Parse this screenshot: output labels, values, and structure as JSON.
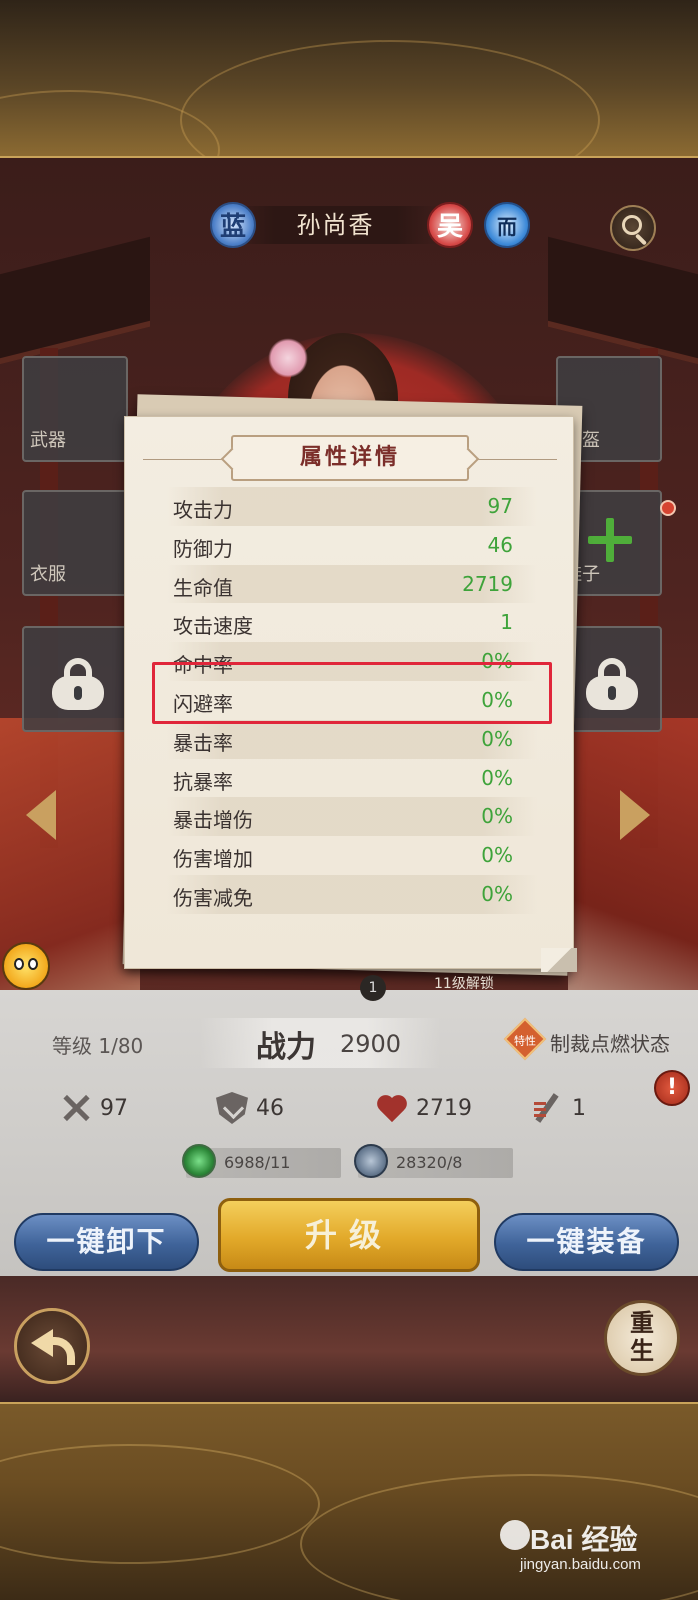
{
  "hero": {
    "name": "孙尚香",
    "rarity_badge": "蓝",
    "faction_badge": "吴",
    "type_badge": "而"
  },
  "equipment": {
    "weapon_label": "武器",
    "helmet_label": "头盔",
    "clothes_label": "衣服",
    "shoes_label": "鞋子"
  },
  "popup": {
    "title": "属性详情",
    "attributes": [
      {
        "name": "攻击力",
        "value": "97"
      },
      {
        "name": "防御力",
        "value": "46"
      },
      {
        "name": "生命值",
        "value": "2719"
      },
      {
        "name": "攻击速度",
        "value": "1"
      },
      {
        "name": "命中率",
        "value": "0%"
      },
      {
        "name": "闪避率",
        "value": "0%"
      },
      {
        "name": "暴击率",
        "value": "0%"
      },
      {
        "name": "抗暴率",
        "value": "0%"
      },
      {
        "name": "暴击增伤",
        "value": "0%"
      },
      {
        "name": "伤害增加",
        "value": "0%"
      },
      {
        "name": "伤害减免",
        "value": "0%"
      }
    ]
  },
  "status": {
    "unlock_count": "1",
    "unlock_text": "11级解锁",
    "level": "等级 1/80",
    "power_label": "战力",
    "power_value": "2900",
    "special_badge": "特性",
    "ignite_status": "制裁点燃状态",
    "alert": "!"
  },
  "stats": {
    "attack": "97",
    "defense": "46",
    "hp": "2719",
    "speed": "1"
  },
  "resources": {
    "jade": "6988/11",
    "coin": "28320/8"
  },
  "actions": {
    "unequip_all": "一键卸下",
    "upgrade": "升级",
    "equip_all": "一键装备"
  },
  "nav": {
    "rebirth_line1": "重",
    "rebirth_line2": "生"
  },
  "watermark": {
    "main": "Bai 经验",
    "sub": "jingyan.baidu.com"
  },
  "colors": {
    "stat_value_green": "#3ea33a",
    "highlight_red": "#e0263a",
    "title_red": "#7b2e2a",
    "upgrade_gold": "#e2a92a",
    "side_button_blue": "#3f6399"
  }
}
